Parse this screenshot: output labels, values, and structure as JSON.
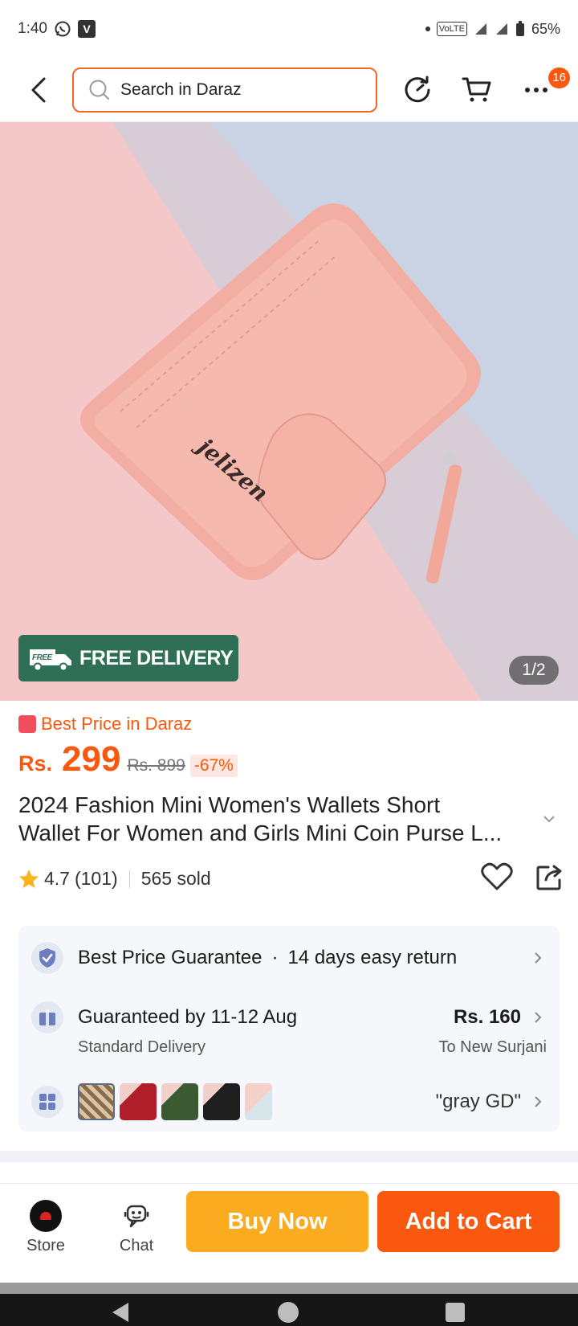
{
  "status_bar": {
    "time": "1:40",
    "battery": "65%",
    "network_label": "VoLTE"
  },
  "header": {
    "search_placeholder": "Search in Daraz",
    "cart_badge": "16"
  },
  "hero": {
    "free_delivery_label": "FREE DELIVERY",
    "free_badge_text": "FREE",
    "image_counter": "1/2",
    "brand_on_wallet": "jelizen"
  },
  "product": {
    "best_price_label": "Best Price in Daraz",
    "currency": "Rs.",
    "price": "299",
    "original_price": "Rs. 899",
    "discount": "-67%",
    "title_line1": "2024 Fashion Mini Women's Wallets Short",
    "title_line2": "Wallet For Women and Girls Mini Coin Purse L...",
    "rating": "4.7",
    "review_count": "(101)",
    "sold": "565 sold"
  },
  "info_card": {
    "guarantee": "Best Price Guarantee",
    "dot": "·",
    "returns": "14 days easy return",
    "delivery_title": "Guaranteed by 11-12 Aug",
    "delivery_fee": "Rs. 160",
    "delivery_type": "Standard Delivery",
    "delivery_location": "To New Surjani",
    "selected_variant": "\"gray GD\""
  },
  "bottom_bar": {
    "store_label": "Store",
    "chat_label": "Chat",
    "buy_now_label": "Buy Now",
    "add_to_cart_label": "Add to Cart"
  },
  "colors": {
    "accent": "#f9580e",
    "buy_now": "#fbab1f",
    "free_delivery_bg": "#2f6f55"
  }
}
